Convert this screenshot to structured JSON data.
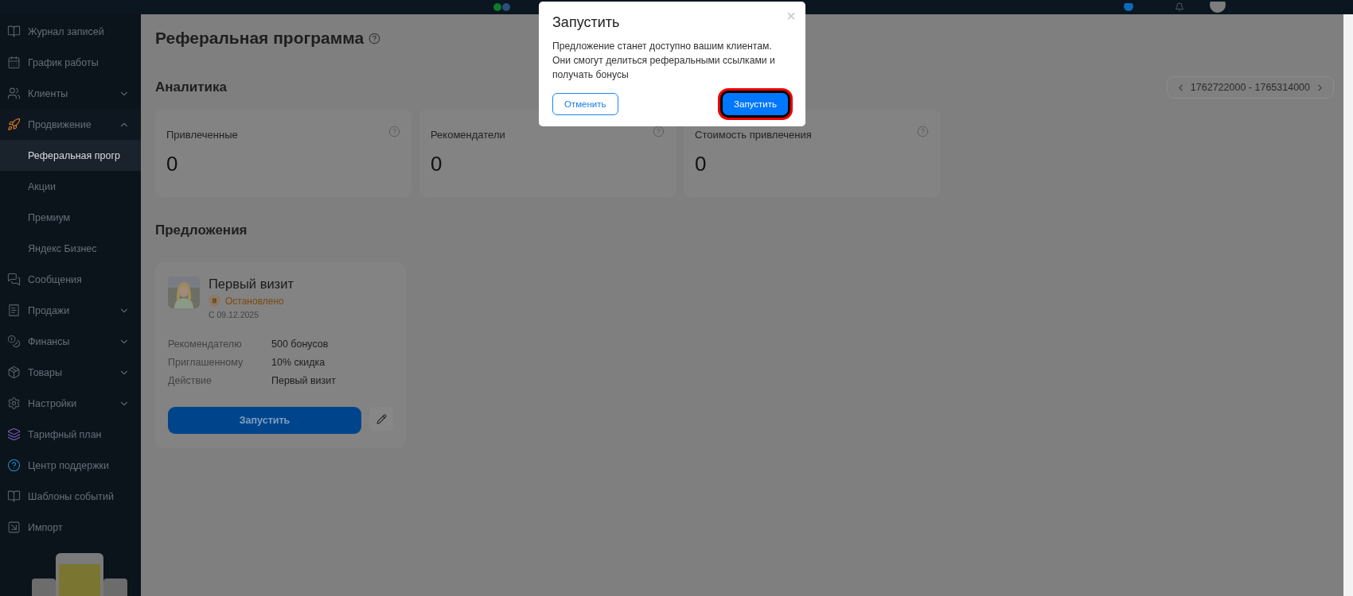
{
  "sidebar": {
    "items": [
      {
        "kind": "link",
        "label": "Журнал записей",
        "selected": false
      },
      {
        "kind": "link",
        "label": "График работы",
        "selected": false
      },
      {
        "kind": "group",
        "label": "Клиенты",
        "selected": false,
        "expanded": false
      },
      {
        "kind": "group",
        "label": "Продвижение",
        "selected": false,
        "expanded": true
      },
      {
        "kind": "sub",
        "label": "Реферальная прогр",
        "selected": true
      },
      {
        "kind": "sub",
        "label": "Акции",
        "selected": false
      },
      {
        "kind": "sub",
        "label": "Премиум",
        "selected": false
      },
      {
        "kind": "sub",
        "label": "Яндекс Бизнес",
        "selected": false
      },
      {
        "kind": "link",
        "label": "Сообщения",
        "selected": false
      },
      {
        "kind": "group",
        "label": "Продажи",
        "selected": false,
        "expanded": false
      },
      {
        "kind": "group",
        "label": "Финансы",
        "selected": false,
        "expanded": false
      },
      {
        "kind": "group",
        "label": "Товары",
        "selected": false,
        "expanded": false
      },
      {
        "kind": "group",
        "label": "Настройки",
        "selected": false,
        "expanded": false
      },
      {
        "kind": "link",
        "label": "Тарифный план",
        "selected": false
      },
      {
        "kind": "link",
        "label": "Центр поддержки",
        "selected": false
      },
      {
        "kind": "link",
        "label": "Шаблоны событий",
        "selected": false
      },
      {
        "kind": "link",
        "label": "Импорт",
        "selected": false
      }
    ]
  },
  "page": {
    "title": "Реферальная программа"
  },
  "analytics": {
    "heading": "Аналитика",
    "date_range": "1762722000 - 1765314000",
    "cards": [
      {
        "label": "Привлеченные",
        "value": "0"
      },
      {
        "label": "Рекомендатели",
        "value": "0"
      },
      {
        "label": "Стоимость привлечения",
        "value": "0"
      }
    ]
  },
  "offers": {
    "heading": "Предложения",
    "items": [
      {
        "title": "Первый визит",
        "status": "Остановлено",
        "stopped": true,
        "date": "С 09.12.2025",
        "details": [
          {
            "label": "Рекомендателю",
            "value": "500 бонусов"
          },
          {
            "label": "Приглашенному",
            "value": "10% скидка"
          },
          {
            "label": "Действие",
            "value": "Первый визит"
          }
        ],
        "button": "Запустить"
      }
    ]
  },
  "modal": {
    "title": "Запустить",
    "close": "×",
    "text": "Предложение станет доступно вашим клиентам. Они смогут делиться реферальными ссылками и получать бонусы",
    "cancel": "Отменить",
    "confirm": "Запустить",
    "confirm_highlighted": true
  }
}
